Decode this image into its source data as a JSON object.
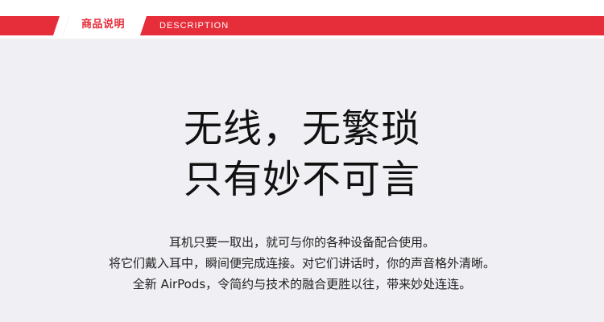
{
  "banner": {
    "title_cn": "商品说明",
    "title_en": "DESCRIPTION",
    "accent_color": "#e62d3a"
  },
  "headline": {
    "line1": "无线，无繁琐",
    "line2": "只有妙不可言"
  },
  "description": {
    "lines": [
      "耳机只要一取出，就可与你的各种设备配合使用。",
      "将它们戴入耳中，瞬间便完成连接。对它们讲话时，你的声音格外清晰。",
      "全新 AirPods，令简约与技术的融合更胜以往，带来妙处连连。"
    ]
  }
}
